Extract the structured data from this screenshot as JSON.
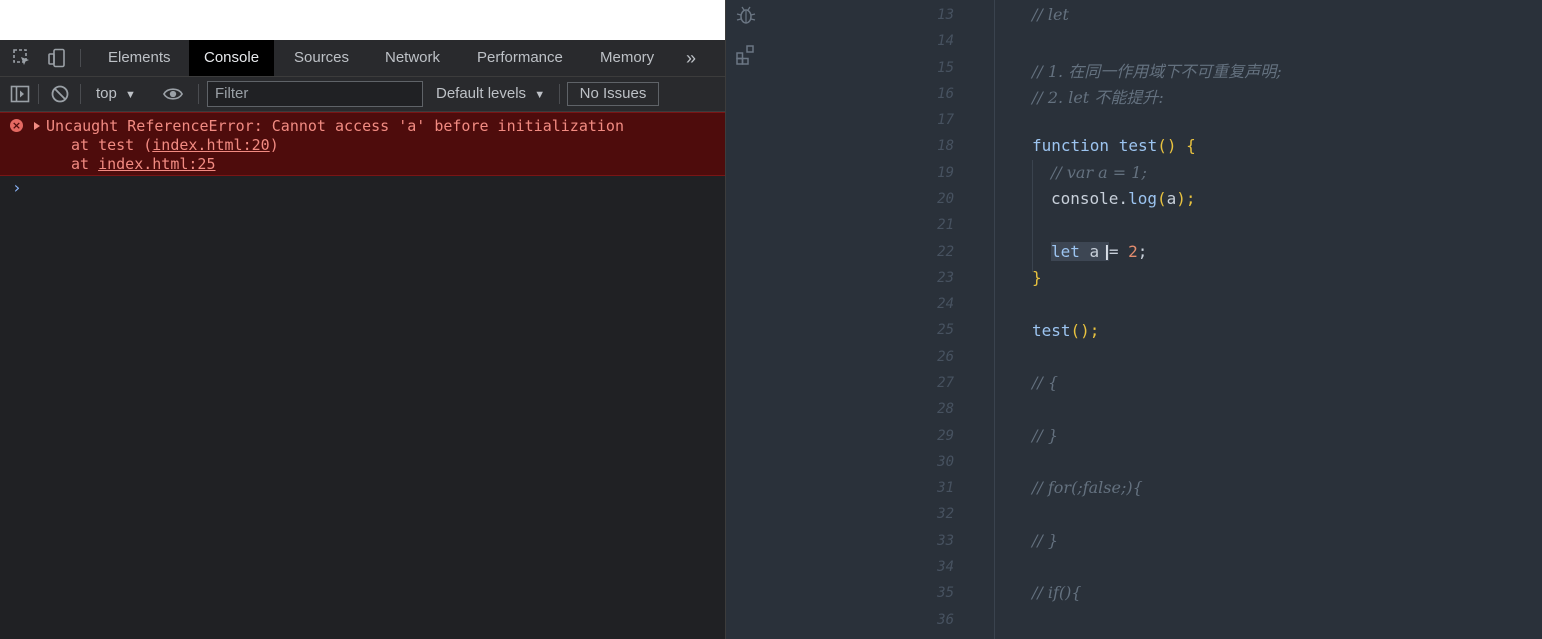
{
  "devtools": {
    "tabs": [
      "Elements",
      "Console",
      "Sources",
      "Network",
      "Performance",
      "Memory"
    ],
    "active_tab": "Console",
    "more_tabs": "»",
    "toolbar": {
      "context": "top",
      "filter_placeholder": "Filter",
      "levels": "Default levels",
      "issues": "No Issues"
    },
    "error": {
      "line1": "Uncaught ReferenceError: Cannot access 'a' before initialization",
      "line2_prefix": "at test (",
      "line2_link": "index.html:20",
      "line2_suffix": ")",
      "line3_prefix": "at ",
      "line3_link": "index.html:25"
    },
    "prompt": "›"
  },
  "editor": {
    "line_numbers": [
      "13",
      "14",
      "15",
      "16",
      "17",
      "18",
      "19",
      "20",
      "21",
      "22",
      "23",
      "24",
      "25",
      "26",
      "27",
      "28",
      "29",
      "30",
      "31",
      "32",
      "33",
      "34",
      "35",
      "36"
    ],
    "lines": {
      "l13": "// let",
      "l15": "// 1. 在同一作用域下不可重复声明;",
      "l16": "// 2. let 不能提升:",
      "l18_kw": "function",
      "l18_fn": "test",
      "l18_br": "() {",
      "l19": "// var a = 1;",
      "l20_obj": "console.",
      "l20_fn": "log",
      "l20_open": "(",
      "l20_arg": "a",
      "l20_close": ");",
      "l22_kw": "let",
      "l22_var": " a ",
      "l22_eq": "=",
      "l22_num": " 2",
      "l22_end": ";",
      "l23": "}",
      "l25_fn": "test",
      "l25_br": "();",
      "l27": "// {",
      "l29": "// }",
      "l31": "// for(;false;){",
      "l33": "// }",
      "l35": "// if(){"
    }
  }
}
